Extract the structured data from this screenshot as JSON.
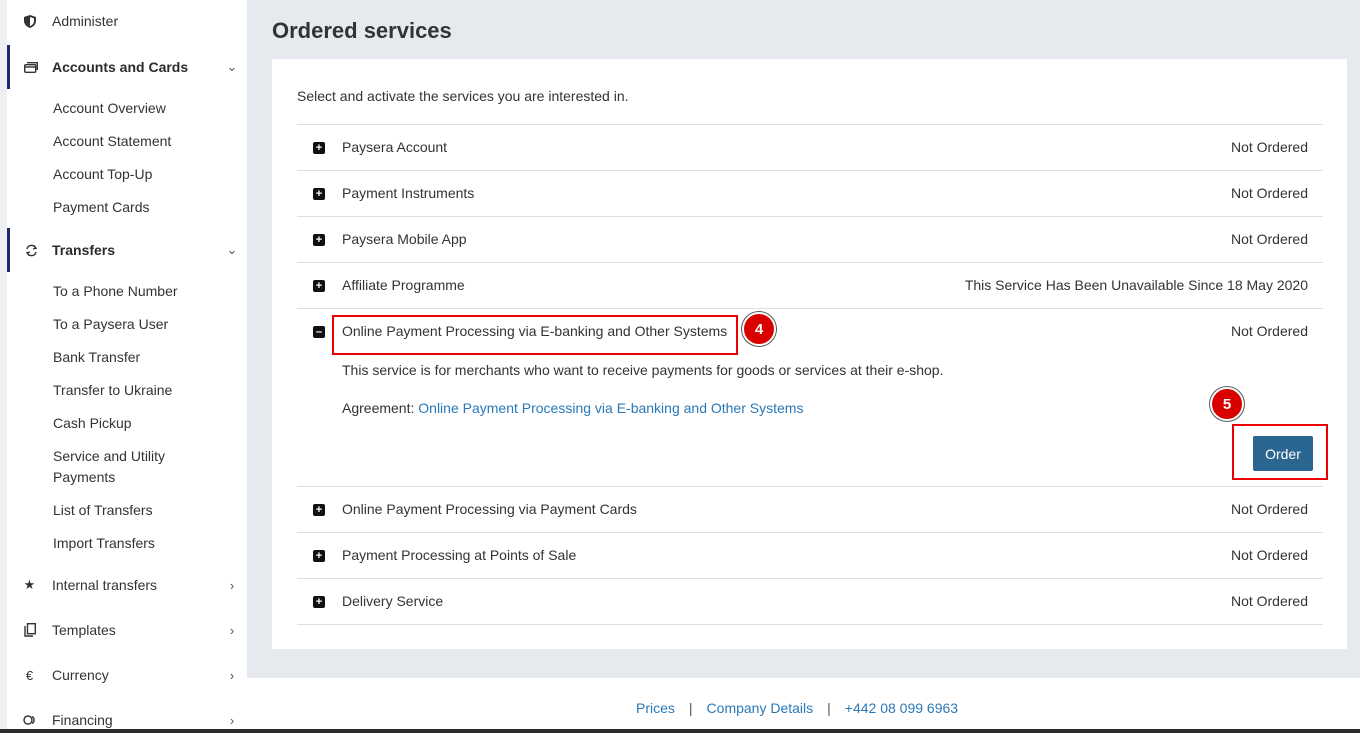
{
  "sidebar": {
    "administer": {
      "label": "Administer",
      "icon": "shield-icon"
    },
    "accounts": {
      "label": "Accounts and Cards",
      "icon": "card-icon",
      "items": [
        "Account Overview",
        "Account Statement",
        "Account Top-Up",
        "Payment Cards"
      ]
    },
    "transfers": {
      "label": "Transfers",
      "icon": "transfer-icon",
      "items": [
        "To a Phone Number",
        "To a Paysera User",
        "Bank Transfer",
        "Transfer to Ukraine",
        "Cash Pickup",
        "Service and Utility Payments",
        "List of Transfers",
        "Import Transfers"
      ]
    },
    "internal": {
      "label": "Internal transfers",
      "icon": "star-icon"
    },
    "templates": {
      "label": "Templates",
      "icon": "copy-icon"
    },
    "currency": {
      "label": "Currency",
      "icon": "euro-icon"
    },
    "financing": {
      "label": "Financing",
      "icon": "financing-icon"
    }
  },
  "main": {
    "title": "Ordered services",
    "intro": "Select and activate the services you are interested in.",
    "services": [
      {
        "name": "Paysera Account",
        "status": "Not Ordered",
        "expanded": false
      },
      {
        "name": "Payment Instruments",
        "status": "Not Ordered",
        "expanded": false
      },
      {
        "name": "Paysera Mobile App",
        "status": "Not Ordered",
        "expanded": false
      },
      {
        "name": "Affiliate Programme",
        "status": "This Service Has Been Unavailable Since 18 May 2020",
        "expanded": false
      },
      {
        "name": "Online Payment Processing via E-banking and Other Systems",
        "status": "Not Ordered",
        "expanded": true
      },
      {
        "name": "Online Payment Processing via Payment Cards",
        "status": "Not Ordered",
        "expanded": false
      },
      {
        "name": "Payment Processing at Points of Sale",
        "status": "Not Ordered",
        "expanded": false
      },
      {
        "name": "Delivery Service",
        "status": "Not Ordered",
        "expanded": false
      }
    ],
    "expanded_detail": {
      "description": "This service is for merchants who want to receive payments for goods or services at their e-shop.",
      "agreement_label": "Agreement:",
      "agreement_link": "Online Payment Processing via E-banking and Other Systems",
      "order_button": "Order"
    },
    "annotations": {
      "step4": "4",
      "step5": "5"
    }
  },
  "footer": {
    "prices": "Prices",
    "company": "Company Details",
    "phone": "+442 08 099 6963",
    "separator": "|"
  },
  "colors": {
    "accent": "#2b6690",
    "link": "#2a78b7",
    "highlight": "#e00000",
    "active_nav_bar": "#1d2a6b"
  }
}
